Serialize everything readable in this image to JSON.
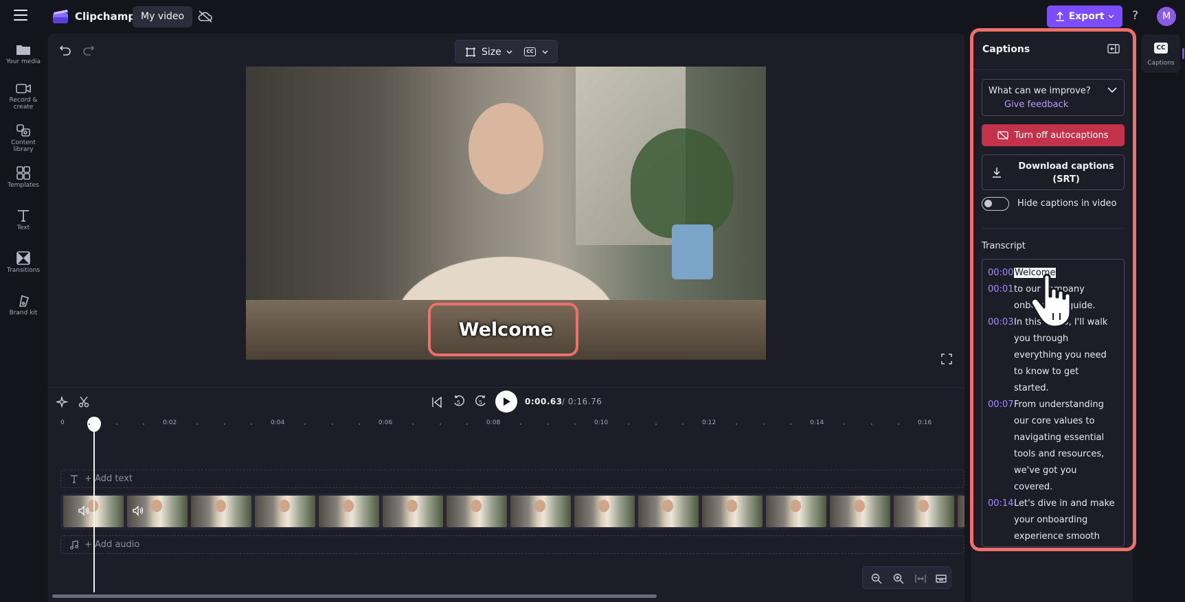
{
  "app": {
    "name": "Clipchamp",
    "project_title": "My video",
    "export_label": "Export",
    "help_label": "?",
    "avatar_initial": "M",
    "accent_color": "#7c4dff"
  },
  "left_nav": [
    {
      "label": "Your media",
      "icon": "folder-icon"
    },
    {
      "label": "Record & create",
      "icon": "camera-icon"
    },
    {
      "label": "Content library",
      "icon": "library-icon"
    },
    {
      "label": "Templates",
      "icon": "templates-icon"
    },
    {
      "label": "Text",
      "icon": "text-icon"
    },
    {
      "label": "Transitions",
      "icon": "transitions-icon"
    },
    {
      "label": "Brand kit",
      "icon": "brand-kit-icon"
    }
  ],
  "preview": {
    "size_label": "Size",
    "cc_label": "CC",
    "caption_overlay": "Welcome"
  },
  "playback": {
    "current_time": "0:00.63",
    "total_time": "/ 0:16.76",
    "rewind_label": "5",
    "forward_label": "5"
  },
  "timeline": {
    "ticks": [
      "0",
      "0:02",
      "0:04",
      "0:06",
      "0:08",
      "0:10",
      "0:12",
      "0:14",
      "0:16"
    ],
    "add_text_label": "+ Add text",
    "add_audio_label": "+ Add audio",
    "playhead_fraction": 0.0376
  },
  "captions_panel": {
    "title": "Captions",
    "feedback_question": "What can we improve?",
    "feedback_link": "Give feedback",
    "autocaptions_button": "Turn off autocaptions",
    "download_button": "Download captions (SRT)",
    "hide_toggle_label": "Hide captions in video",
    "hide_toggle_on": false,
    "transcript_title": "Transcript",
    "transcript": [
      {
        "time": "00:00",
        "lines": [
          "Welcome"
        ]
      },
      {
        "time": "00:01",
        "lines": [
          "to our company",
          "onboarding guide."
        ]
      },
      {
        "time": "00:03",
        "lines": [
          "In this video, I'll walk",
          "you through",
          "everything you need",
          "to know to get",
          "started."
        ]
      },
      {
        "time": "00:07",
        "lines": [
          "From understanding",
          "our core values to",
          "navigating essential",
          "tools and resources,",
          "we've got you",
          "covered."
        ]
      },
      {
        "time": "00:14",
        "lines": [
          "Let's dive in and make",
          "your onboarding",
          "experience smooth"
        ]
      }
    ]
  },
  "right_rail": {
    "tab_label": "Captions",
    "tab_icon_text": "CC"
  }
}
